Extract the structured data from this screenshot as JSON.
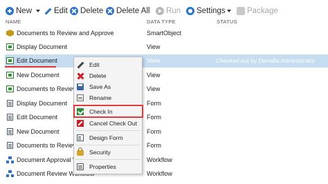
{
  "toolbar": {
    "new_label": "New",
    "edit_label": "Edit",
    "delete_label": "Delete",
    "delete_all_label": "Delete All",
    "run_label": "Run",
    "settings_label": "Settings",
    "package_label": "Package"
  },
  "columns": {
    "name": "NAME",
    "data_type": "DATA TYPE",
    "status": "STATUS"
  },
  "rows": [
    {
      "name": "Documents to Review and Approve",
      "type": "SmartObject",
      "status": "",
      "icon": "smartobject-icon"
    },
    {
      "name": "Display Document",
      "type": "View",
      "status": "",
      "icon": "view-icon"
    },
    {
      "name": "Edit Document",
      "type": "View",
      "status": "Checked out by Denallix Administrator",
      "icon": "view-icon",
      "selected": true
    },
    {
      "name": "New Document",
      "type": "View",
      "status": "",
      "icon": "view-icon"
    },
    {
      "name": "Documents to Review",
      "type": "View",
      "status": "",
      "icon": "view-icon"
    },
    {
      "name": "Display Document",
      "type": "Form",
      "status": "",
      "icon": "form-icon"
    },
    {
      "name": "Edit Document",
      "type": "Form",
      "status": "",
      "icon": "form-icon"
    },
    {
      "name": "New Document",
      "type": "Form",
      "status": "",
      "icon": "form-icon"
    },
    {
      "name": "Documents to Review",
      "type": "Form",
      "status": "",
      "icon": "form-icon"
    },
    {
      "name": "Document Approval W",
      "type": "Workflow",
      "status": "",
      "icon": "workflow-icon"
    },
    {
      "name": "Document Review Workflow",
      "type": "Workflow",
      "status": "",
      "icon": "workflow-icon"
    }
  ],
  "context_menu": {
    "items": [
      {
        "label": "Edit",
        "icon": "edit-icon"
      },
      {
        "label": "Delete",
        "icon": "delete-icon"
      },
      {
        "label": "Save As",
        "icon": "save-icon"
      },
      {
        "label": "Rename",
        "icon": "rename-icon"
      },
      {
        "label": "Check In",
        "icon": "check-in-icon",
        "highlighted": true
      },
      {
        "label": "Cancel Check Out",
        "icon": "cancel-checkout-icon"
      },
      {
        "label": "Design Form",
        "icon": "design-form-icon"
      },
      {
        "label": "Security",
        "icon": "security-icon"
      },
      {
        "label": "Properties",
        "icon": "properties-icon"
      }
    ]
  },
  "colors": {
    "accent": "#2b72c8",
    "selection": "#c6dcf0",
    "highlight_border": "#e03a3a"
  }
}
